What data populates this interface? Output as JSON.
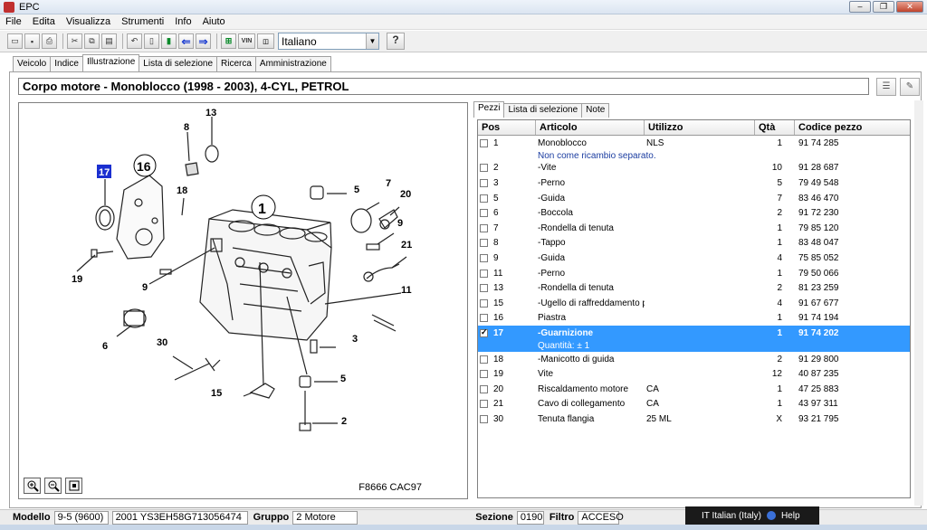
{
  "window": {
    "title": "EPC"
  },
  "menu": [
    "File",
    "Edita",
    "Visualizza",
    "Strumenti",
    "Info",
    "Aiuto"
  ],
  "toolbar": {
    "vin_label": "VIN",
    "language": "Italiano",
    "help_label": "?"
  },
  "main_tabs": [
    "Veicolo",
    "Indice",
    "Illustrazione",
    "Lista di selezione",
    "Ricerca",
    "Amministrazione"
  ],
  "active_main_tab": "Illustrazione",
  "section_title": "Corpo motore - Monoblocco   (1998 - 2003), 4-CYL, PETROL",
  "illustration": {
    "code": "F8666 CAC97",
    "callouts": [
      "13",
      "8",
      "17",
      "16",
      "18",
      "1",
      "5",
      "7",
      "20",
      "9",
      "21",
      "19",
      "9",
      "11",
      "6",
      "30",
      "3",
      "5",
      "15",
      "2"
    ]
  },
  "parts_tabs": [
    "Pezzi",
    "Lista di selezione",
    "Note"
  ],
  "columns": [
    "Pos",
    "Articolo",
    "Utilizzo",
    "Qtà",
    "Codice pezzo"
  ],
  "parts": [
    {
      "pos": "1",
      "articolo": "Monoblocco",
      "utilizzo": "NLS",
      "qta": "1",
      "codice": "91 74 285",
      "note": "Non come ricambio separato."
    },
    {
      "pos": "2",
      "articolo": "-Vite",
      "utilizzo": "",
      "qta": "10",
      "codice": "91 28 687"
    },
    {
      "pos": "3",
      "articolo": "-Perno",
      "utilizzo": "",
      "qta": "5",
      "codice": "79 49 548"
    },
    {
      "pos": "5",
      "articolo": "-Guida",
      "utilizzo": "",
      "qta": "7",
      "codice": "83 46 470"
    },
    {
      "pos": "6",
      "articolo": "-Boccola",
      "utilizzo": "",
      "qta": "2",
      "codice": "91 72 230"
    },
    {
      "pos": "7",
      "articolo": "-Rondella di tenuta",
      "utilizzo": "",
      "qta": "1",
      "codice": "79 85 120"
    },
    {
      "pos": "8",
      "articolo": "-Tappo",
      "utilizzo": "",
      "qta": "1",
      "codice": "83 48 047"
    },
    {
      "pos": "9",
      "articolo": "-Guida",
      "utilizzo": "",
      "qta": "4",
      "codice": "75 85 052"
    },
    {
      "pos": "11",
      "articolo": "-Perno",
      "utilizzo": "",
      "qta": "1",
      "codice": "79 50 066"
    },
    {
      "pos": "13",
      "articolo": "-Rondella di tenuta",
      "utilizzo": "",
      "qta": "2",
      "codice": "81 23 259"
    },
    {
      "pos": "15",
      "articolo": "-Ugello di raffreddamento pistone",
      "utilizzo": "",
      "qta": "4",
      "codice": "91 67 677"
    },
    {
      "pos": "16",
      "articolo": "Piastra",
      "utilizzo": "",
      "qta": "1",
      "codice": "91 74 194"
    },
    {
      "pos": "17",
      "articolo": "-Guarnizione",
      "utilizzo": "",
      "qta": "1",
      "codice": "91 74 202",
      "note": "Quantità: ± 1",
      "selected": true
    },
    {
      "pos": "18",
      "articolo": "-Manicotto di guida",
      "utilizzo": "",
      "qta": "2",
      "codice": "91 29 800"
    },
    {
      "pos": "19",
      "articolo": "Vite",
      "utilizzo": "",
      "qta": "12",
      "codice": "40 87 235"
    },
    {
      "pos": "20",
      "articolo": "Riscaldamento motore",
      "utilizzo": "CA",
      "qta": "1",
      "codice": "47 25 883"
    },
    {
      "pos": "21",
      "articolo": "Cavo di collegamento",
      "utilizzo": "CA",
      "qta": "1",
      "codice": "43 97 311"
    },
    {
      "pos": "30",
      "articolo": "Tenuta flangia",
      "utilizzo": "25 ML",
      "qta": "X",
      "codice": "93 21 795"
    }
  ],
  "status": {
    "modello_label": "Modello",
    "modello": "9-5 (9600)",
    "vin": "2001 YS3EH58G713056474",
    "gruppo_label": "Gruppo",
    "gruppo": "2 Motore",
    "sezione_label": "Sezione",
    "sezione": "0190",
    "filtro_label": "Filtro",
    "filtro": "ACCESO"
  },
  "taskbar": {
    "language": "IT Italian (Italy)",
    "help": "Help"
  },
  "colors": {
    "selection": "#3399ff",
    "note_text": "#1a3ca0",
    "callout_highlight": "#1a2fd0"
  }
}
